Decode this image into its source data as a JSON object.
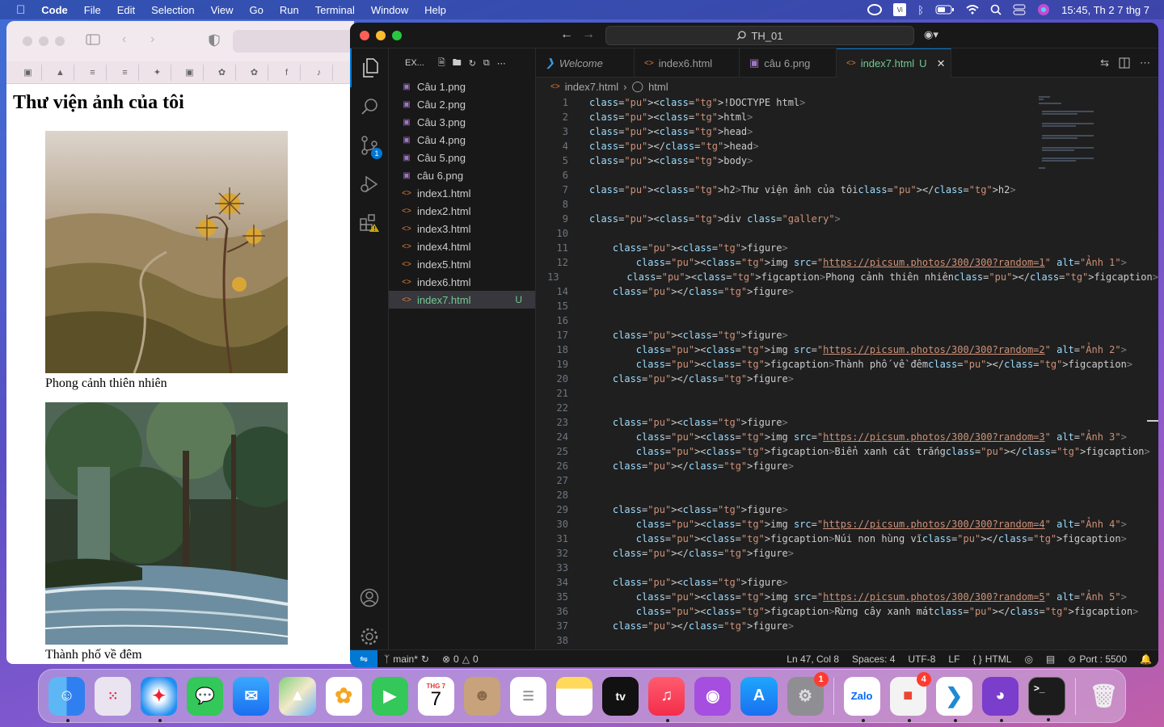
{
  "menubar": {
    "app": "Code",
    "items": [
      "File",
      "Edit",
      "Selection",
      "View",
      "Go",
      "Run",
      "Terminal",
      "Window",
      "Help"
    ],
    "clock": "15:45, Th 2 7 thg 7"
  },
  "browser": {
    "page_title": "Thư viện ảnh của tôi",
    "figures": [
      {
        "caption": "Phong cảnh thiên nhiên"
      },
      {
        "caption": "Thành phố về đêm"
      }
    ]
  },
  "vscode": {
    "search": "TH_01",
    "explorer": {
      "title": "EX...",
      "files": [
        {
          "name": "Câu 1.png",
          "type": "png"
        },
        {
          "name": "Câu 2.png",
          "type": "png"
        },
        {
          "name": "Câu 3.png",
          "type": "png"
        },
        {
          "name": "Câu 4.png",
          "type": "png"
        },
        {
          "name": "Câu 5.png",
          "type": "png"
        },
        {
          "name": "câu 6.png",
          "type": "png"
        },
        {
          "name": "index1.html",
          "type": "html"
        },
        {
          "name": "index2.html",
          "type": "html"
        },
        {
          "name": "index3.html",
          "type": "html"
        },
        {
          "name": "index4.html",
          "type": "html"
        },
        {
          "name": "index5.html",
          "type": "html"
        },
        {
          "name": "index6.html",
          "type": "html"
        },
        {
          "name": "index7.html",
          "type": "html",
          "selected": true,
          "badge": "U"
        }
      ]
    },
    "tabs": [
      {
        "label": "Welcome",
        "icon": "vscode-icon"
      },
      {
        "label": "index6.html",
        "icon": "html-icon"
      },
      {
        "label": "câu 6.png",
        "icon": "image-icon"
      },
      {
        "label": "index7.html",
        "icon": "html-icon",
        "active": true,
        "badge": "U"
      }
    ],
    "breadcrumb": [
      "index7.html",
      "html"
    ],
    "code_lines": [
      "<!DOCTYPE html>",
      "<html>",
      "<head>",
      "</head>",
      "<body>",
      "",
      "<h2>Thư viện ảnh của tôi</h2>",
      "",
      "<div class=\"gallery\">",
      "",
      "    <figure>",
      "        <img src=\"https://picsum.photos/300/300?random=1\" alt=\"Ảnh 1\">",
      "        <figcaption>Phong cảnh thiên nhiên</figcaption>",
      "    </figure>",
      "",
      "",
      "    <figure>",
      "        <img src=\"https://picsum.photos/300/300?random=2\" alt=\"Ảnh 2\">",
      "        <figcaption>Thành phố về đêm</figcaption>",
      "    </figure>",
      "",
      "",
      "    <figure>",
      "        <img src=\"https://picsum.photos/300/300?random=3\" alt=\"Ảnh 3\">",
      "        <figcaption>Biển xanh cát trắng</figcaption>",
      "    </figure>",
      "",
      "",
      "    <figure>",
      "        <img src=\"https://picsum.photos/300/300?random=4\" alt=\"Ảnh 4\">",
      "        <figcaption>Núi non hùng vĩ</figcaption>",
      "    </figure>",
      "",
      "    <figure>",
      "        <img src=\"https://picsum.photos/300/300?random=5\" alt=\"Ảnh 5\">",
      "        <figcaption>Rừng cây xanh mát</figcaption>",
      "    </figure>",
      ""
    ],
    "status": {
      "branch": "main*",
      "errors": "0",
      "warnings": "0",
      "cursor": "Ln 47, Col 8",
      "spaces": "Spaces: 4",
      "encoding": "UTF-8",
      "eol": "LF",
      "language": "HTML",
      "port": "Port : 5500"
    },
    "source_control_badge": "1"
  },
  "dock": {
    "calendar_month": "THG 7",
    "calendar_day": "7",
    "settings_badge": "1",
    "office_badge": "4",
    "zalo_label": "Zalo",
    "tv_label": "tv"
  },
  "colors": {
    "accent": "#0078d4",
    "modified": "#73c991",
    "keyword": "#569cd6",
    "attribute": "#9cdcfe",
    "string": "#ce9178"
  }
}
